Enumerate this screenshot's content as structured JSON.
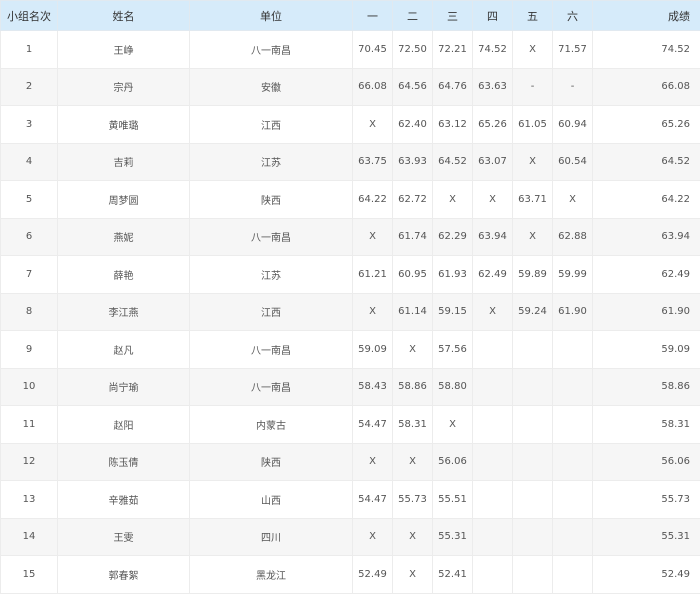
{
  "headers": {
    "rank": "小组名次",
    "name": "姓名",
    "unit": "单位",
    "a1": "一",
    "a2": "二",
    "a3": "三",
    "a4": "四",
    "a5": "五",
    "a6": "六",
    "score": "成绩"
  },
  "rows": [
    {
      "rank": "1",
      "name": "王峥",
      "unit": "八一南昌",
      "a": [
        "70.45",
        "72.50",
        "72.21",
        "74.52",
        "X",
        "71.57"
      ],
      "score": "74.52"
    },
    {
      "rank": "2",
      "name": "宗丹",
      "unit": "安徽",
      "a": [
        "66.08",
        "64.56",
        "64.76",
        "63.63",
        "-",
        "-"
      ],
      "score": "66.08"
    },
    {
      "rank": "3",
      "name": "黄唯璐",
      "unit": "江西",
      "a": [
        "X",
        "62.40",
        "63.12",
        "65.26",
        "61.05",
        "60.94"
      ],
      "score": "65.26"
    },
    {
      "rank": "4",
      "name": "吉莉",
      "unit": "江苏",
      "a": [
        "63.75",
        "63.93",
        "64.52",
        "63.07",
        "X",
        "60.54"
      ],
      "score": "64.52"
    },
    {
      "rank": "5",
      "name": "周梦圆",
      "unit": "陕西",
      "a": [
        "64.22",
        "62.72",
        "X",
        "X",
        "63.71",
        "X"
      ],
      "score": "64.22"
    },
    {
      "rank": "6",
      "name": "燕妮",
      "unit": "八一南昌",
      "a": [
        "X",
        "61.74",
        "62.29",
        "63.94",
        "X",
        "62.88"
      ],
      "score": "63.94"
    },
    {
      "rank": "7",
      "name": "薛艳",
      "unit": "江苏",
      "a": [
        "61.21",
        "60.95",
        "61.93",
        "62.49",
        "59.89",
        "59.99"
      ],
      "score": "62.49"
    },
    {
      "rank": "8",
      "name": "李江燕",
      "unit": "江西",
      "a": [
        "X",
        "61.14",
        "59.15",
        "X",
        "59.24",
        "61.90"
      ],
      "score": "61.90"
    },
    {
      "rank": "9",
      "name": "赵凡",
      "unit": "八一南昌",
      "a": [
        "59.09",
        "X",
        "57.56",
        "",
        "",
        ""
      ],
      "score": "59.09"
    },
    {
      "rank": "10",
      "name": "尚宁瑜",
      "unit": "八一南昌",
      "a": [
        "58.43",
        "58.86",
        "58.80",
        "",
        "",
        ""
      ],
      "score": "58.86"
    },
    {
      "rank": "11",
      "name": "赵阳",
      "unit": "内蒙古",
      "a": [
        "54.47",
        "58.31",
        "X",
        "",
        "",
        ""
      ],
      "score": "58.31"
    },
    {
      "rank": "12",
      "name": "陈玉倩",
      "unit": "陕西",
      "a": [
        "X",
        "X",
        "56.06",
        "",
        "",
        ""
      ],
      "score": "56.06"
    },
    {
      "rank": "13",
      "name": "辛雅茹",
      "unit": "山西",
      "a": [
        "54.47",
        "55.73",
        "55.51",
        "",
        "",
        ""
      ],
      "score": "55.73"
    },
    {
      "rank": "14",
      "name": "王雯",
      "unit": "四川",
      "a": [
        "X",
        "X",
        "55.31",
        "",
        "",
        ""
      ],
      "score": "55.31"
    },
    {
      "rank": "15",
      "name": "郭春絮",
      "unit": "黑龙江",
      "a": [
        "52.49",
        "X",
        "52.41",
        "",
        "",
        ""
      ],
      "score": "52.49"
    }
  ]
}
